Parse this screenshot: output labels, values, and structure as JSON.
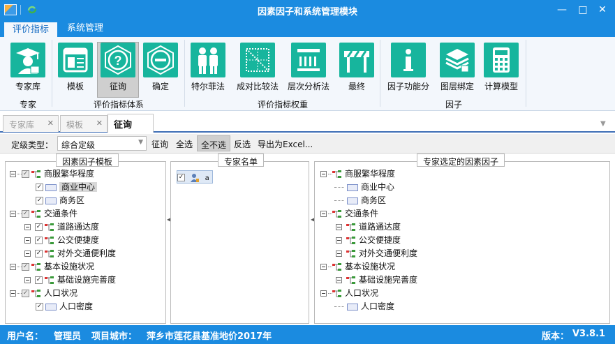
{
  "window": {
    "title": "因素因子和系统管理模块",
    "minimize": "—",
    "maximize": "□",
    "close": "✕"
  },
  "ribbon_tabs": [
    {
      "label": "评价指标",
      "active": true
    },
    {
      "label": "系统管理",
      "active": false
    }
  ],
  "ribbon": {
    "buttons": [
      {
        "label": "专家库",
        "icon": "expert-icon"
      },
      {
        "label": "模板",
        "icon": "template-icon"
      },
      {
        "label": "征询",
        "icon": "question-icon",
        "selected": true
      },
      {
        "label": "确定",
        "icon": "confirm-icon"
      },
      {
        "label": "特尔菲法",
        "icon": "delphi-icon"
      },
      {
        "label": "成对比较法",
        "icon": "pairwise-icon"
      },
      {
        "label": "层次分析法",
        "icon": "ahp-icon"
      },
      {
        "label": "最终",
        "icon": "final-icon"
      },
      {
        "label": "因子功能分",
        "icon": "info-icon"
      },
      {
        "label": "图层绑定",
        "icon": "layer-icon"
      },
      {
        "label": "计算模型",
        "icon": "calculator-icon"
      }
    ],
    "groups": [
      "专家",
      "评价指标体系",
      "评价指标权重",
      "因子"
    ]
  },
  "doc_tabs": [
    {
      "label": "专家库",
      "close": "✕"
    },
    {
      "label": "模板",
      "close": "✕"
    },
    {
      "label": "征询",
      "active": true
    }
  ],
  "toolbar": {
    "grade_type_label": "定级类型：",
    "grade_type_value": "综合定级",
    "buttons": [
      "征询",
      "全选",
      "全不选",
      "反选",
      "导出为Excel..."
    ],
    "pressed_index": 2
  },
  "panels": {
    "template": {
      "title": "因素因子模板",
      "items": [
        {
          "label": "商服繁华程度",
          "children": [
            {
              "label": "商业中心",
              "selected": true
            },
            {
              "label": "商务区"
            }
          ]
        },
        {
          "label": "交通条件",
          "children": [
            {
              "label": "道路通达度"
            },
            {
              "label": "公交便捷度"
            },
            {
              "label": "对外交通便利度"
            }
          ]
        },
        {
          "label": "基本设施状况",
          "children": [
            {
              "label": "基础设施完善度"
            }
          ]
        },
        {
          "label": "人口状况",
          "children": [
            {
              "label": "人口密度"
            }
          ]
        }
      ]
    },
    "experts": {
      "title": "专家名单",
      "items": [
        {
          "label": "a"
        }
      ]
    },
    "selected_factors": {
      "title": "专家选定的因素因子",
      "items": [
        {
          "label": "商服繁华程度",
          "children": [
            {
              "label": "商业中心"
            },
            {
              "label": "商务区"
            }
          ]
        },
        {
          "label": "交通条件",
          "children": [
            {
              "label": "道路通达度"
            },
            {
              "label": "公交便捷度"
            },
            {
              "label": "对外交通便利度"
            }
          ]
        },
        {
          "label": "基本设施状况",
          "children": [
            {
              "label": "基础设施完善度"
            }
          ]
        },
        {
          "label": "人口状况",
          "children": [
            {
              "label": "人口密度"
            }
          ]
        }
      ]
    }
  },
  "status": {
    "user_label": "用户名：",
    "user_value": "管理员",
    "city_label": "项目城市：",
    "city_value": "萍乡市莲花县基准地价2017年",
    "version_label": "版本：",
    "version_value": "V3.8.1"
  },
  "colors": {
    "titlebar": "#1b8be0",
    "ribbon_icon": "#17b59d",
    "ribbon_bg": "#f3f7fc"
  }
}
